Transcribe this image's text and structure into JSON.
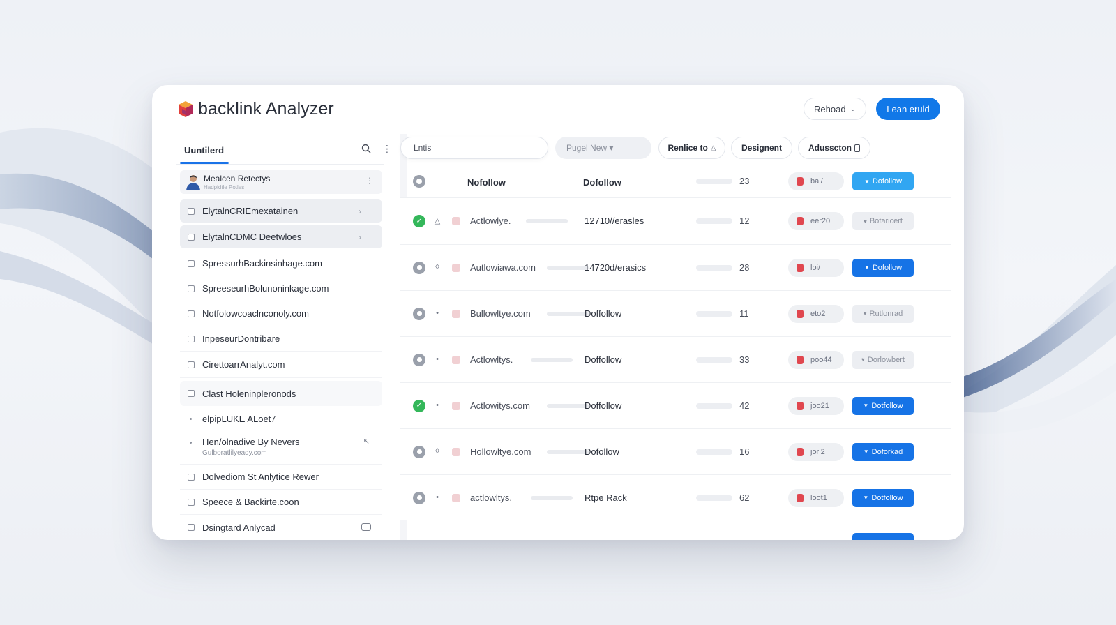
{
  "app": {
    "title": "backlink Analyzer"
  },
  "header": {
    "reload_label": "Rehoad",
    "learn_label": "Lean eruld"
  },
  "sidebar": {
    "tab_label": "Uuntilerd",
    "profile": {
      "name": "Mealcen Retectys",
      "sub": "Hadpidtle Potles"
    },
    "items": [
      {
        "label": "ElytalnCRIEmexatainen",
        "kind": "shaded"
      },
      {
        "label": "ElytalnCDMC Deetwloes",
        "kind": "shaded"
      },
      {
        "label": "SpressurhBackinsinhage.com",
        "kind": "plain"
      },
      {
        "label": "SpreeseurhBolunoninkage.com",
        "kind": "plain"
      },
      {
        "label": "Notfolowcoaclnconoly.com",
        "kind": "plain"
      },
      {
        "label": "InpeseurDontribare",
        "kind": "plain"
      },
      {
        "label": "CirettoarrAnalyt.com",
        "kind": "plain"
      },
      {
        "label": "Clast Holeninpleronods",
        "kind": "light"
      },
      {
        "label": "elpipLUKE ALoet7",
        "kind": "dot"
      },
      {
        "label": "Hen/olnadive By Nevers",
        "sub": "Gulboratlilyeady.com",
        "kind": "two-line"
      },
      {
        "label": "Dolvediom St Anlytice Rewer",
        "kind": "plain"
      },
      {
        "label": "Speece & Backirte.coon",
        "kind": "plain"
      },
      {
        "label": "Dsingtard Anlycad",
        "kind": "plain"
      }
    ]
  },
  "filters": {
    "search_value": "Lntis",
    "select_label": "Pugel New ▾",
    "chips": [
      "Renlice to",
      "Designent",
      "Adusscton"
    ]
  },
  "table": {
    "headers": {
      "col1": "Nofollow",
      "col2": "Dofollow",
      "count": "23",
      "pill": "bal/",
      "action": "Dofollow"
    },
    "rows": [
      {
        "status": "ok",
        "domain": "Actlowlye.",
        "anchor": "12710//erasles",
        "count": "12",
        "pill": "eer20",
        "action": "Bofaricert",
        "style": "muted"
      },
      {
        "status": "pending",
        "domain": "Autlowiawa.com",
        "anchor": "14720d/erasics",
        "count": "28",
        "pill": "loi/",
        "action": "Dofollow",
        "style": "primary"
      },
      {
        "status": "pending",
        "domain": "Bullowltye.com",
        "anchor": "Doffollow",
        "count": "11",
        "pill": "eto2",
        "action": "Rutlonrad",
        "style": "muted"
      },
      {
        "status": "pending",
        "domain": "Actlowltys.",
        "anchor": "Doffollow",
        "count": "33",
        "pill": "poo44",
        "action": "Dorlowbert",
        "style": "muted"
      },
      {
        "status": "ok",
        "domain": "Actlowitys.com",
        "anchor": "Doffollow",
        "count": "42",
        "pill": "joo21",
        "action": "Dotfollow",
        "style": "primary"
      },
      {
        "status": "pending",
        "domain": "Hollowltye.com",
        "anchor": "Dofollow",
        "count": "16",
        "pill": "jorl2",
        "action": "Doforkad",
        "style": "primary"
      },
      {
        "status": "pending",
        "domain": "actlowltys.",
        "anchor": "Rtpe Rack",
        "count": "62",
        "pill": "loot1",
        "action": "Dotfollow",
        "style": "primary"
      }
    ]
  },
  "colors": {
    "accent": "#1673e6",
    "success": "#34b75a",
    "danger": "#e0474f"
  }
}
